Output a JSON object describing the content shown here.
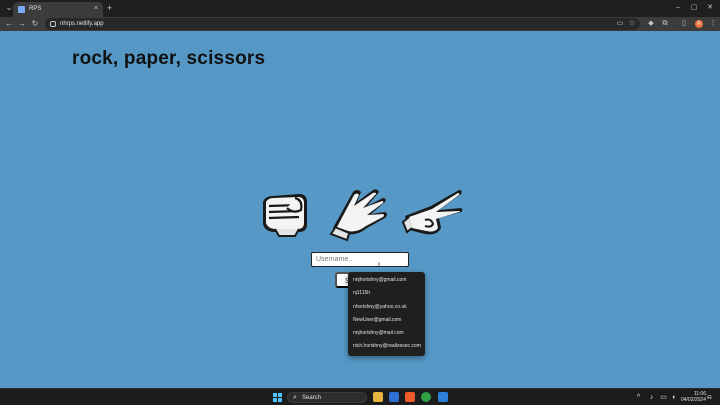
{
  "browser": {
    "tab_title": "RPS",
    "tab_close": "×",
    "new_tab": "+",
    "url": "nhrps.netlify.app",
    "profile_initial": "R",
    "icons": [
      "tab-search-icon",
      "back-icon",
      "forward-icon",
      "reload-icon",
      "site-info-icon",
      "cast-icon",
      "bookmark-star-icon",
      "extension-icon",
      "puzzle-icon",
      "split-view-icon",
      "menu-dots-icon"
    ]
  },
  "page": {
    "title": "rock, paper, scissors",
    "hands": [
      "rock",
      "paper",
      "scissors"
    ],
    "username_placeholder": "Username..",
    "submit_label": "Submit",
    "background": "#5598c6"
  },
  "autofill": {
    "items": [
      "nnjhorishny@gmail.com",
      "nj1115h",
      "nhorishny@yahoo.co.uk",
      "NewUser@gmail.com",
      "nnjhorishny@mail.com",
      "nich.horishny@realizesec.com"
    ]
  },
  "taskbar": {
    "search_label": "Search",
    "time": "11:06",
    "date": "04/02/2024"
  }
}
